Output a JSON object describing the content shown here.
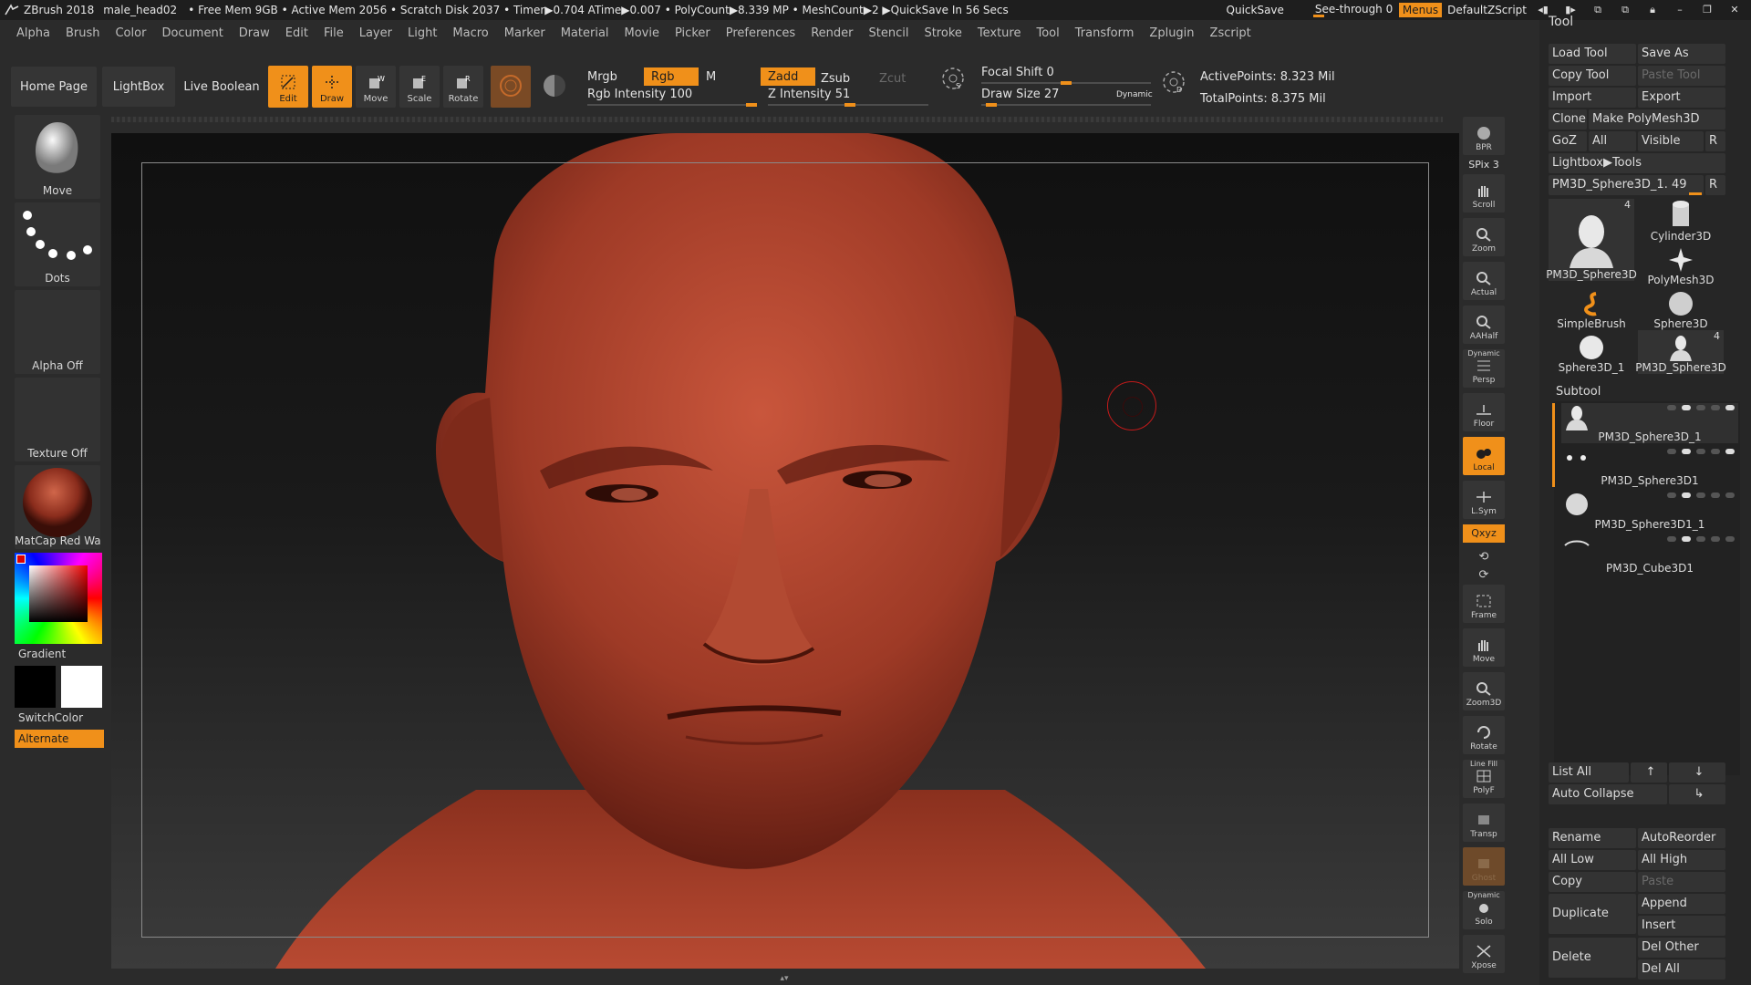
{
  "titlebar": {
    "app": "ZBrush 2018",
    "document": "male_head02",
    "stats": "• Free Mem 9GB • Active Mem 2056 • Scratch Disk 2037 • Timer▶0.704 ATime▶0.007 • PolyCount▶8.339 MP • MeshCount▶2 ▶QuickSave In 56 Secs",
    "quicksave": "QuickSave",
    "see_through": "See-through  0",
    "menus": "Menus",
    "default_zscript": "DefaultZScript"
  },
  "menubar": [
    "Alpha",
    "Brush",
    "Color",
    "Document",
    "Draw",
    "Edit",
    "File",
    "Layer",
    "Light",
    "Macro",
    "Marker",
    "Material",
    "Movie",
    "Picker",
    "Preferences",
    "Render",
    "Stencil",
    "Stroke",
    "Texture",
    "Tool",
    "Transform",
    "Zplugin",
    "Zscript"
  ],
  "shelf": {
    "home_page": "Home Page",
    "lightbox": "LightBox",
    "live_boolean": "Live Boolean",
    "edit": "Edit",
    "draw": "Draw",
    "move": "Move",
    "scale": "Scale",
    "rotate": "Rotate",
    "mrgb": "Mrgb",
    "rgb": "Rgb",
    "m": "M",
    "zadd": "Zadd",
    "zsub": "Zsub",
    "zcut": "Zcut",
    "rgb_intensity": "Rgb Intensity 100",
    "z_intensity": "Z Intensity 51",
    "focal_shift": "Focal Shift 0",
    "draw_size": "Draw Size 27",
    "dynamic": "Dynamic",
    "active_points": "ActivePoints: 8.323 Mil",
    "total_points": "TotalPoints: 8.375 Mil",
    "rgb_intensity_value": 100,
    "z_intensity_value": 51,
    "focal_shift_value": 0,
    "draw_size_value": 27
  },
  "left_tray": {
    "brush": "Move",
    "stroke": "Dots",
    "alpha": "Alpha Off",
    "texture": "Texture Off",
    "material": "MatCap Red Wax",
    "gradient": "Gradient",
    "switch_color": "SwitchColor",
    "alternate": "Alternate"
  },
  "right_shelf": {
    "bpr": "BPR",
    "spix": "SPix 3",
    "scroll": "Scroll",
    "zoom": "Zoom",
    "actual": "Actual",
    "aahalf": "AAHalf",
    "dynamic_persp": "Dynamic",
    "persp": "Persp",
    "floor": "Floor",
    "local": "Local",
    "lsym": "L.Sym",
    "xyz": "Qxyz",
    "frame": "Frame",
    "move": "Move",
    "zoom3d": "Zoom3D",
    "rotate": "Rotate",
    "line_fill": "Line Fill",
    "polyf": "PolyF",
    "transp": "Transp",
    "ghost": "Ghost",
    "dynamic_solo": "Dynamic",
    "solo": "Solo",
    "xpose": "Xpose"
  },
  "tool_panel": {
    "title": "Tool",
    "load_tool": "Load Tool",
    "save_as": "Save As",
    "copy_tool": "Copy Tool",
    "paste_tool": "Paste Tool",
    "import": "Import",
    "export": "Export",
    "clone": "Clone",
    "make_polymesh": "Make PolyMesh3D",
    "goz": "GoZ",
    "all": "All",
    "visible": "Visible",
    "r": "R",
    "lightbox_tools": "Lightbox▶Tools",
    "current_tool": "PM3D_Sphere3D_1. 49",
    "r2": "R",
    "tools": [
      {
        "name": "PM3D_Sphere3D",
        "count": "4"
      },
      {
        "name": "Cylinder3D",
        "count": ""
      },
      {
        "name": "PolyMesh3D",
        "count": ""
      },
      {
        "name": "SimpleBrush",
        "count": ""
      },
      {
        "name": "Sphere3D",
        "count": ""
      },
      {
        "name": "Sphere3D_1",
        "count": ""
      },
      {
        "name": "PM3D_Sphere3D",
        "count": "4"
      }
    ],
    "subtool_title": "Subtool",
    "subtools": [
      "PM3D_Sphere3D_1",
      "PM3D_Sphere3D1",
      "PM3D_Sphere3D1_1",
      "PM3D_Cube3D1"
    ],
    "list_all": "List All",
    "auto_collapse": "Auto Collapse",
    "rename": "Rename",
    "autoreorder": "AutoReorder",
    "all_low": "All Low",
    "all_high": "All High",
    "copy": "Copy",
    "paste": "Paste",
    "append": "Append",
    "duplicate": "Duplicate",
    "insert": "Insert",
    "delete": "Delete",
    "del_other": "Del Other",
    "del_all": "Del All"
  },
  "colors": {
    "accent": "#f0901a",
    "skin": "#a8402c",
    "background": "#2b2b2b"
  }
}
